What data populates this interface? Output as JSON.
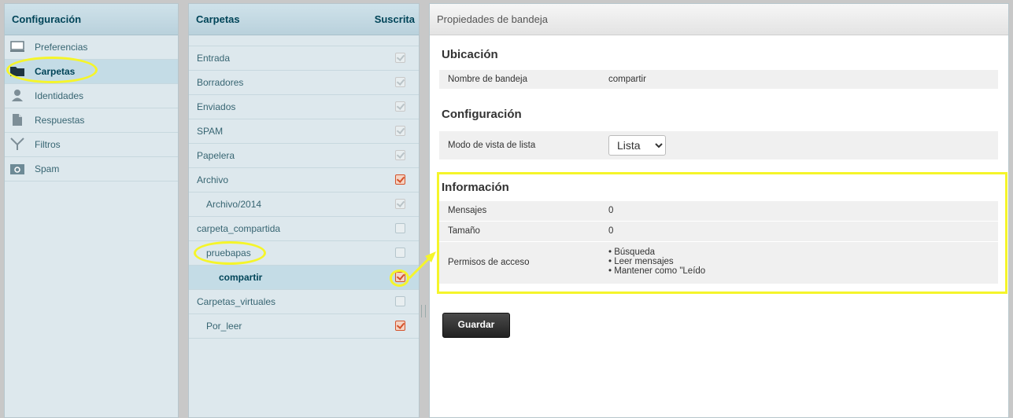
{
  "settings": {
    "header": "Configuración",
    "items": [
      {
        "label": "Preferencias",
        "icon": "monitor-icon"
      },
      {
        "label": "Carpetas",
        "icon": "folder-icon"
      },
      {
        "label": "Identidades",
        "icon": "person-icon"
      },
      {
        "label": "Respuestas",
        "icon": "document-icon"
      },
      {
        "label": "Filtros",
        "icon": "filter-icon"
      },
      {
        "label": "Spam",
        "icon": "spam-icon"
      }
    ]
  },
  "folders": {
    "header": "Carpetas",
    "subscribed_header": "Suscrita",
    "rows": [
      {
        "label": "Entrada",
        "checked": true
      },
      {
        "label": "Borradores",
        "checked": true
      },
      {
        "label": "Enviados",
        "checked": true
      },
      {
        "label": "SPAM",
        "checked": true
      },
      {
        "label": "Papelera",
        "checked": true
      },
      {
        "label": "Archivo",
        "checked": true
      },
      {
        "label": "Archivo/2014",
        "checked": true
      },
      {
        "label": "carpeta_compartida",
        "checked": false
      },
      {
        "label": "pruebapas",
        "checked": false
      },
      {
        "label": "compartir",
        "checked": true
      },
      {
        "label": "Carpetas_virtuales",
        "checked": false
      },
      {
        "label": "Por_leer",
        "checked": true
      }
    ]
  },
  "props": {
    "header": "Propiedades de bandeja",
    "location": {
      "title": "Ubicación",
      "name_label": "Nombre de bandeja",
      "name_value": "compartir"
    },
    "config": {
      "title": "Configuración",
      "mode_label": "Modo de vista de lista",
      "mode_value": "Lista"
    },
    "info": {
      "title": "Información",
      "messages_label": "Mensajes",
      "messages_value": "0",
      "size_label": "Tamaño",
      "size_value": "0",
      "perms_label": "Permisos de acceso",
      "perms": [
        "Búsqueda",
        "Leer mensajes",
        "Mantener como \"Leído"
      ]
    },
    "save_label": "Guardar"
  },
  "colors": {
    "highlight": "#f5f52a",
    "active_check": "#d4522b",
    "header_text": "#004458"
  }
}
